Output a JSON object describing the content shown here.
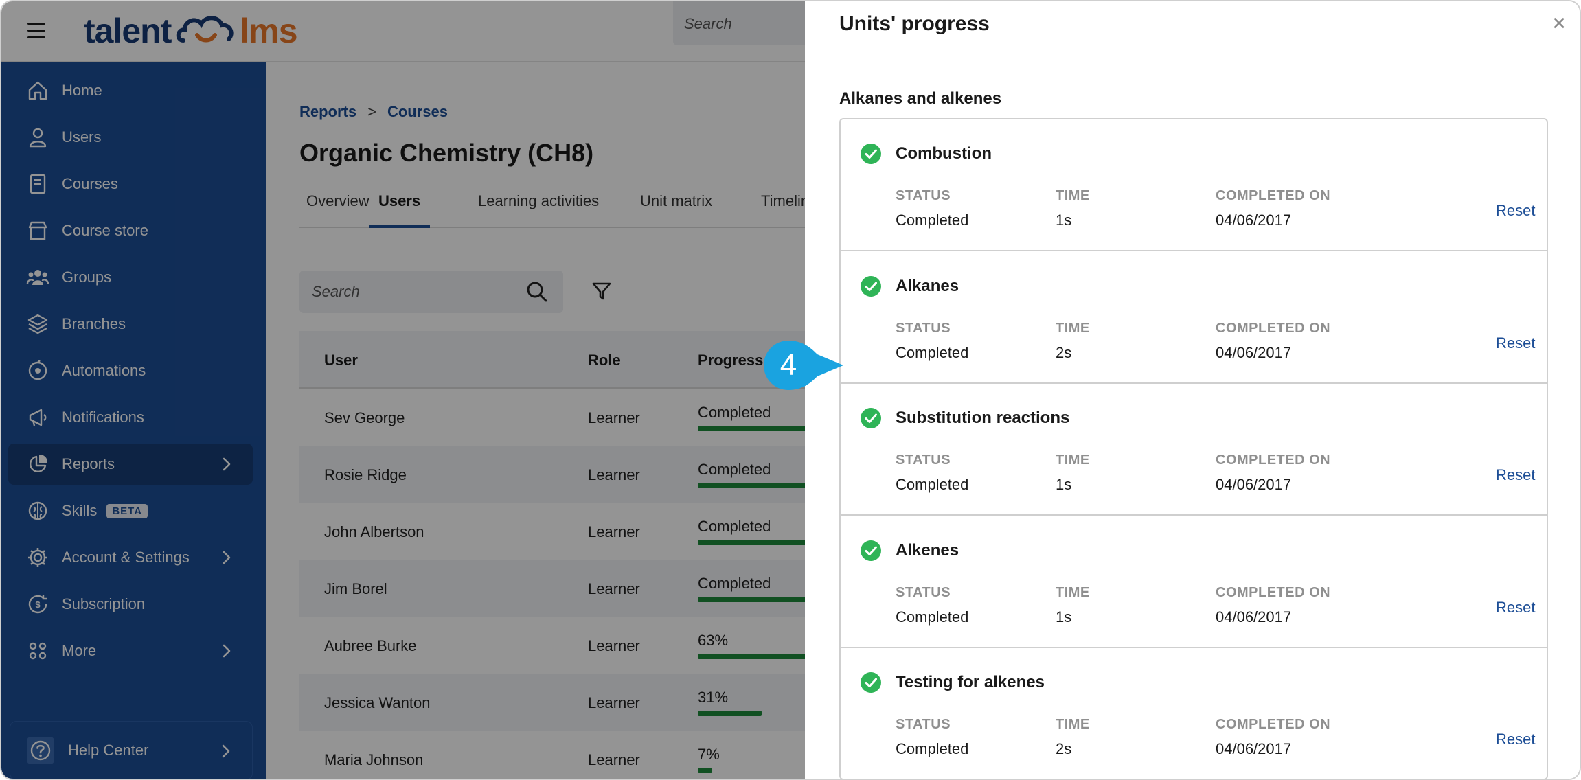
{
  "topbar": {
    "logo_left": "talent",
    "logo_right": "lms",
    "search_placeholder": "Search"
  },
  "sidebar": {
    "items": [
      {
        "label": "Home",
        "icon": "home-icon"
      },
      {
        "label": "Users",
        "icon": "user-icon"
      },
      {
        "label": "Courses",
        "icon": "book-icon"
      },
      {
        "label": "Course store",
        "icon": "store-icon"
      },
      {
        "label": "Groups",
        "icon": "groups-icon"
      },
      {
        "label": "Branches",
        "icon": "layers-icon"
      },
      {
        "label": "Automations",
        "icon": "automation-icon"
      },
      {
        "label": "Notifications",
        "icon": "megaphone-icon"
      },
      {
        "label": "Reports",
        "icon": "pie-chart-icon",
        "active": true
      },
      {
        "label": "Skills",
        "icon": "brain-icon",
        "badge": "BETA"
      },
      {
        "label": "Account & Settings",
        "icon": "gear-icon"
      },
      {
        "label": "Subscription",
        "icon": "subscription-icon"
      },
      {
        "label": "More",
        "icon": "grid-icon"
      }
    ],
    "help_label": "Help Center"
  },
  "main": {
    "breadcrumb": [
      "Reports",
      "Courses"
    ],
    "breadcrumb_separator": ">",
    "title": "Organic Chemistry (CH8)",
    "tabs": [
      "Overview",
      "Users",
      "Learning activities",
      "Unit matrix",
      "Timeline"
    ],
    "active_tab": "Users",
    "search_placeholder": "Search",
    "table": {
      "headers": [
        "User",
        "Role",
        "Progress"
      ],
      "rows": [
        {
          "user": "Sev George",
          "role": "Learner",
          "progress": "Completed",
          "progress_fraction": 1.0
        },
        {
          "user": "Rosie Ridge",
          "role": "Learner",
          "progress": "Completed",
          "progress_fraction": 1.0
        },
        {
          "user": "John Albertson",
          "role": "Learner",
          "progress": "Completed",
          "progress_fraction": 1.0
        },
        {
          "user": "Jim Borel",
          "role": "Learner",
          "progress": "Completed",
          "progress_fraction": 1.0
        },
        {
          "user": "Aubree Burke",
          "role": "Learner",
          "progress": "63%",
          "progress_fraction": 0.63
        },
        {
          "user": "Jessica Wanton",
          "role": "Learner",
          "progress": "31%",
          "progress_fraction": 0.31
        },
        {
          "user": "Maria Johnson",
          "role": "Learner",
          "progress": "7%",
          "progress_fraction": 0.07
        }
      ]
    }
  },
  "panel": {
    "title": "Units' progress",
    "close_glyph": "×",
    "section": "Alkanes and alkenes",
    "labels": {
      "status": "STATUS",
      "time": "TIME",
      "completed_on": "COMPLETED ON",
      "reset": "Reset"
    },
    "units": [
      {
        "name": "Combustion",
        "status": "Completed",
        "time": "1s",
        "completed_on": "04/06/2017"
      },
      {
        "name": "Alkanes",
        "status": "Completed",
        "time": "2s",
        "completed_on": "04/06/2017"
      },
      {
        "name": "Substitution reactions",
        "status": "Completed",
        "time": "1s",
        "completed_on": "04/06/2017"
      },
      {
        "name": "Alkenes",
        "status": "Completed",
        "time": "1s",
        "completed_on": "04/06/2017"
      },
      {
        "name": "Testing for alkenes",
        "status": "Completed",
        "time": "2s",
        "completed_on": "04/06/2017"
      }
    ]
  },
  "callout": {
    "number": "4"
  },
  "colors": {
    "sidebar": "#1d4e96",
    "sidebar_active": "#173d76",
    "accent_blue": "#1d4e96",
    "logo_orange": "#e8782a",
    "check_green": "#2fb457",
    "progress_green": "#1e8a3b",
    "callout_blue": "#1aa3e0"
  }
}
